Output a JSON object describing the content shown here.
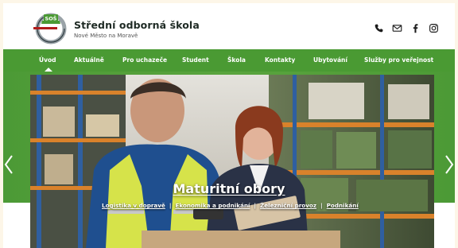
{
  "brand": {
    "name": "Střední odborná škola",
    "subtitle": "Nové Město na Moravě",
    "logo_text": "SOŠ"
  },
  "header_icons": [
    "phone-icon",
    "mail-icon",
    "facebook-icon",
    "instagram-icon"
  ],
  "nav": {
    "items": [
      {
        "label": "Úvod",
        "active": true
      },
      {
        "label": "Aktuálně"
      },
      {
        "label": "Pro uchazeče"
      },
      {
        "label": "Student"
      },
      {
        "label": "Škola"
      },
      {
        "label": "Kontakty"
      },
      {
        "label": "Ubytování"
      },
      {
        "label": "Služby pro veřejnost"
      }
    ]
  },
  "slider": {
    "title": "Maturitní obory",
    "links": [
      "Logistika v dopravě",
      "Ekonomika a podnikání",
      "Železniční provoz",
      "Podnikání"
    ],
    "separator": "|"
  },
  "colors": {
    "green": "#4a9a33",
    "header_bg": "#ffffff",
    "page_bg": "#fdf6e8"
  }
}
